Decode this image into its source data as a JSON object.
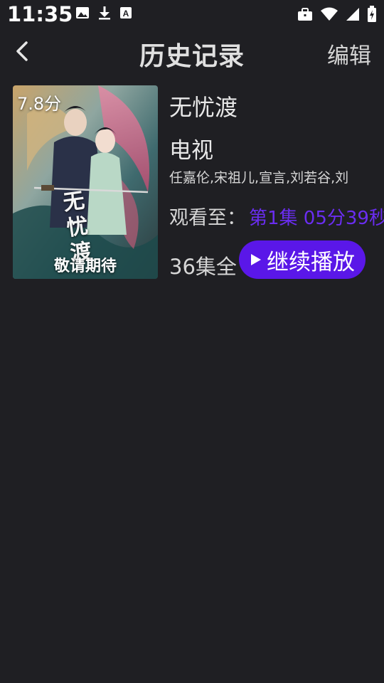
{
  "status_bar": {
    "time": "11:35",
    "left_icons": [
      "image-icon",
      "download-icon",
      "font-icon"
    ],
    "right_icons": [
      "briefcase-icon",
      "wifi-icon",
      "signal-icon",
      "battery-charging-icon"
    ]
  },
  "header": {
    "back_icon": "chevron-left-icon",
    "title": "历史记录",
    "edit_label": "编辑"
  },
  "history": [
    {
      "rating": "7.8分",
      "poster_caption": "敬请期待",
      "poster_logo": "无忧渡",
      "title": "无忧渡",
      "type": "电视",
      "cast": "任嘉伦,宋祖儿,宣言,刘若谷,刘",
      "watch_label": "观看至：",
      "watch_progress": "第1集 05分39秒",
      "episodes": "36集全",
      "continue_label": "继续播放",
      "continue_icon": "play-icon"
    }
  ],
  "colors": {
    "background": "#1f1f23",
    "accent": "#5a17e8",
    "progress_text": "#6a2df0"
  }
}
